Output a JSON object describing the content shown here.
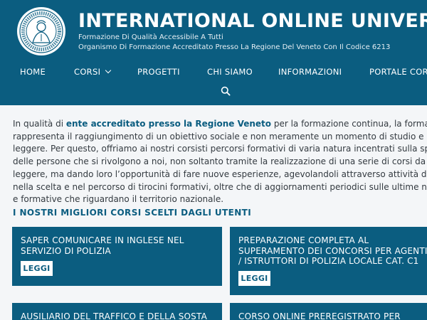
{
  "header": {
    "site_title": "INTERNATIONAL ONLINE UNIVERSI",
    "tagline_1": "Formazione Di Qualità Accessibile A Tutti",
    "tagline_2": "Organismo Di Formazione Accreditato Presso La Regione Del Veneto Con Il Codice 6213",
    "logo_icon": "university-seal-logo"
  },
  "nav": {
    "items": [
      {
        "label": "HOME"
      },
      {
        "label": "CORSI",
        "icon": "chevron-down-icon"
      },
      {
        "label": "PROGETTI"
      },
      {
        "label": "CHI SIAMO"
      },
      {
        "label": "INFORMAZIONI"
      },
      {
        "label": "PORTALE CORS"
      }
    ],
    "search_icon": "search-icon"
  },
  "main": {
    "intro_lines": [
      {
        "before": "In qualità di ",
        "highlight": "ente accreditato presso la Regione Veneto",
        "after": " per la formazione continua, la formazione per"
      },
      {
        "text": "rappresenta il raggiungimento di un obiettivo sociale e non meramente un momento di studio e di libri"
      },
      {
        "text": "leggere. Per questo, offriamo ai nostri corsisti percorsi formativi di varia natura incentrati sulla specializzazio"
      },
      {
        "text": "delle persone che si rivolgono a noi, non soltanto tramite la realizzazione di una serie di corsi da seguire e libri"
      },
      {
        "text": "leggere, ma dando loro l’opportunità di fare nuove esperienze, agevolandoli attraverso attività di affiancame"
      },
      {
        "text": "nella scelta e nel percorso di tirocini formativi, oltre che di aggiornamenti periodici sulle ultime novità normat"
      },
      {
        "text": "e formative che riguardano il territorio nazionale."
      }
    ],
    "section_title": "I NOSTRI MIGLIORI CORSI SCELTI DAGLI UTENTI",
    "cards": [
      {
        "title": "SAPER COMUNICARE IN INGLESE NEL SERVIZIO DI POLIZIA",
        "button": "LEGGI"
      },
      {
        "title": "PREPARAZIONE COMPLETA AL SUPERAMENTO DEI CONCORSI PER AGENTI / ISTRUTTORI DI POLIZIA LOCALE CAT. C1",
        "button": "LEGGI"
      },
      {
        "title": "AUSILIARIO DEL TRAFFICO E DELLA SOSTA",
        "button": ""
      },
      {
        "title": "CORSO ONLINE PREREGISTRATO PER",
        "button": ""
      }
    ]
  },
  "colors": {
    "brand_blue": "#0b5d80",
    "content_bg": "#f4f6f8",
    "text": "#333a40"
  }
}
